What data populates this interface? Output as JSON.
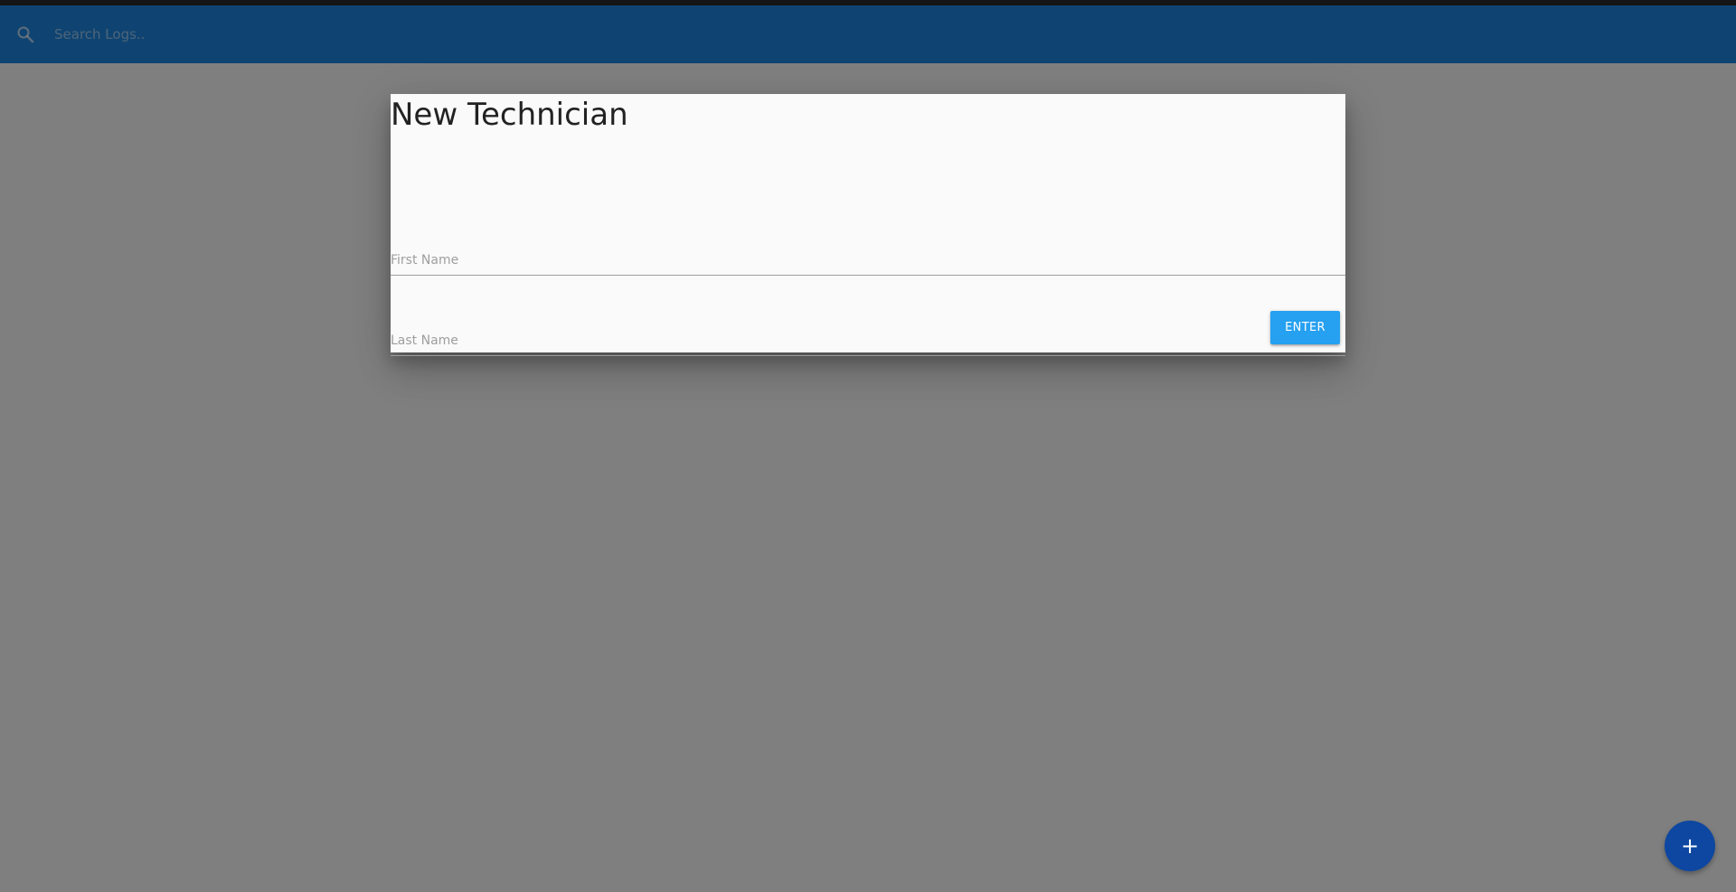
{
  "navbar": {
    "search_placeholder": "Search Logs..",
    "search_icon": "search-icon",
    "color": "#1e88e5"
  },
  "modal": {
    "title": "New Technician",
    "fields": [
      {
        "placeholder": "First Name",
        "value": ""
      },
      {
        "placeholder": "Last Name",
        "value": ""
      }
    ],
    "enter_label": "ENTER",
    "enter_color": "#26a0f0"
  },
  "fab": {
    "icon": "plus-icon",
    "glyph": "+",
    "color": "#0d47a1"
  }
}
